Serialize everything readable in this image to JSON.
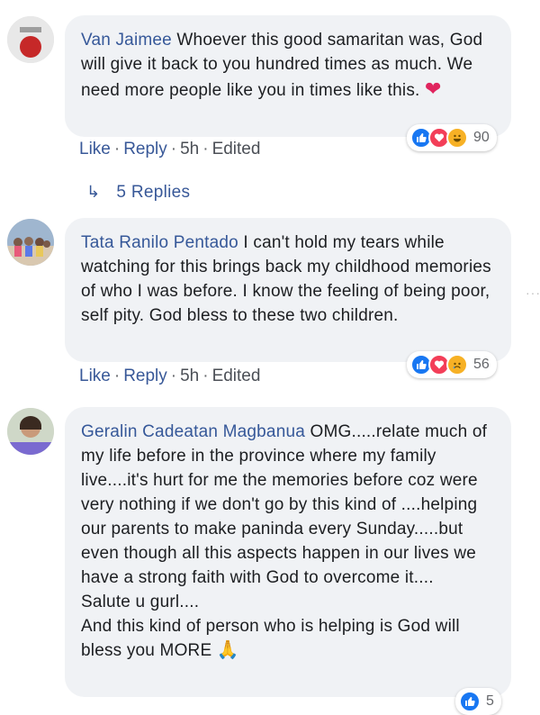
{
  "comments": [
    {
      "author": "Van Jaimee",
      "text": "Whoever this good samaritan was, God will give it back to you hundred times as much. We need more people like you in times like this.",
      "emoji": "❤",
      "actions": {
        "like": "Like",
        "reply": "Reply",
        "time": "5h",
        "edited": "Edited"
      },
      "reaction_count": "90",
      "reactions": [
        "like-icon",
        "love-icon",
        "haha-icon"
      ],
      "replies_label": "5 Replies"
    },
    {
      "author": "Tata Ranilo Pentado",
      "text": "I can't hold my tears while watching for this brings back my childhood memories of who I was before. I know the feeling of being poor, self pity. God bless to these two children.",
      "actions": {
        "like": "Like",
        "reply": "Reply",
        "time": "5h",
        "edited": "Edited"
      },
      "reaction_count": "56",
      "reactions": [
        "like-icon",
        "love-icon",
        "sad-icon"
      ]
    },
    {
      "author": "Geralin Cadeatan Magbanua",
      "text_lines": [
        "OMG.....relate much of my life before in the province where my family live....it's hurt for me the memories before coz were very nothing if we don't go by this kind of ....helping our parents to make paninda every Sunday.....but even though all this aspects happen in our lives we have a strong faith with God to overcome it....",
        "Salute u gurl....",
        "And this kind of person who is helping is God will bless you MORE"
      ],
      "emoji": "🙏",
      "reaction_count": "5",
      "reactions": [
        "like-icon"
      ]
    }
  ],
  "colors": {
    "author": "#365899",
    "bubble": "#f0f2f5",
    "like": "#1877f2",
    "love": "#f33e58",
    "haha": "#f7b125"
  }
}
